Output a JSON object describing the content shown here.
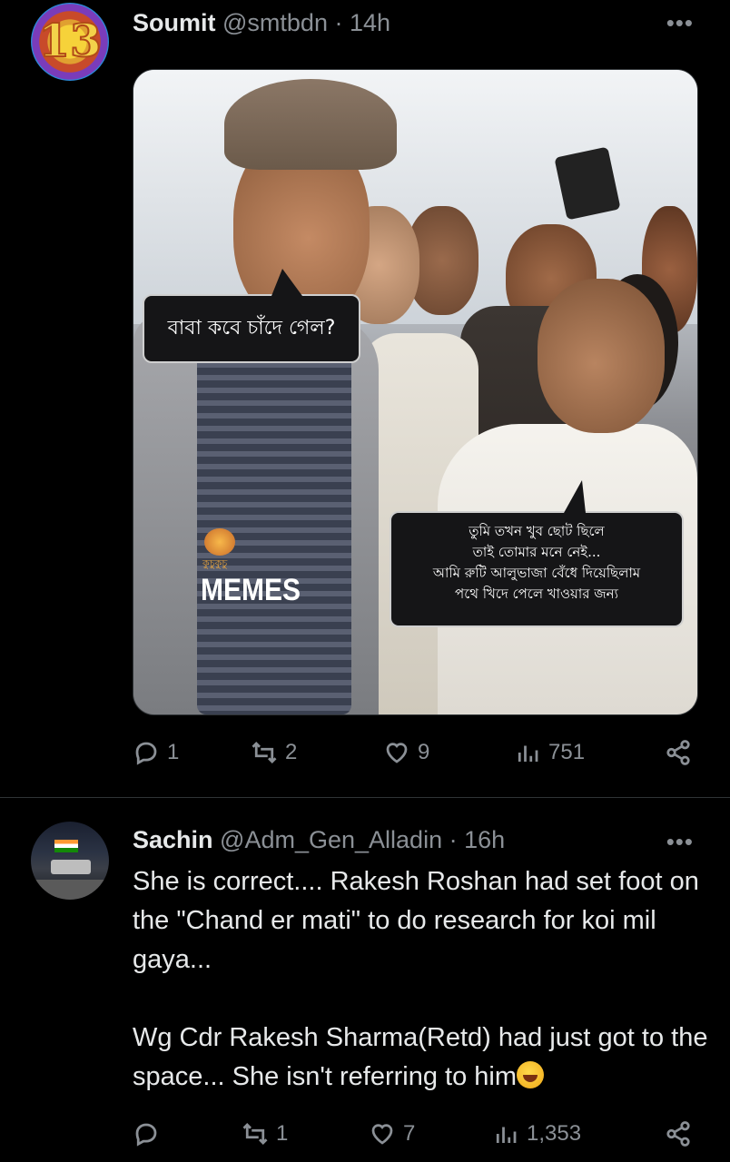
{
  "post1": {
    "name": "Soumit",
    "handle": "@smtbdn",
    "separator": "·",
    "time": "14h",
    "avatar_text": "13",
    "more": "•••",
    "media": {
      "bubble_left": "বাবা কবে চাঁদে গেল?",
      "bubble_right_lines": [
        "তুমি তখন খুব ছোট ছিলে",
        "তাই তোমার মনে নেই...",
        "আমি রুটি আলুভাজা বেঁধে দিয়েছিলাম",
        "পথে খিদে পেলে খাওয়ার জন্য"
      ],
      "logo_small": "কুচুকুচু",
      "logo_text": "MEMES"
    },
    "actions": {
      "replies": "1",
      "reposts": "2",
      "likes": "9",
      "views": "751"
    }
  },
  "post2": {
    "name": "Sachin",
    "handle": "@Adm_Gen_Alladin",
    "separator": "·",
    "time": "16h",
    "more": "•••",
    "text_p1": "She is correct.... Rakesh Roshan had set foot on the \"Chand er mati\" to do research for koi mil gaya...",
    "text_p2": "Wg Cdr Rakesh Sharma(Retd) had just got to the space... She isn't referring to him",
    "actions": {
      "replies": "",
      "reposts": "1",
      "likes": "7",
      "views": "1,353"
    }
  },
  "colors": {
    "background": "#000000",
    "text": "#e7e9ea",
    "muted": "#8b9096",
    "divider": "#2f3336"
  },
  "icons": [
    "reply-icon",
    "repost-icon",
    "like-icon",
    "views-icon",
    "share-icon",
    "more-icon"
  ]
}
